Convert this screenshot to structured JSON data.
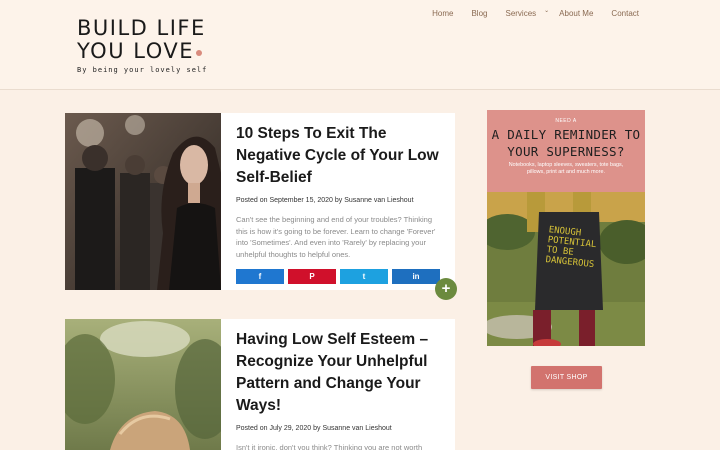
{
  "logo": {
    "line1": "BUILD LIFE",
    "line2": "YOU LOVE",
    "tagline": "By being your lovely self"
  },
  "nav": {
    "items": [
      "Home",
      "Blog",
      "Services",
      "About Me",
      "Contact"
    ]
  },
  "posts": [
    {
      "title": "10 Steps To Exit The Negative Cycle of Your Low Self-Belief",
      "meta_prefix": "Posted on",
      "date": "September 15, 2020",
      "meta_by": "by",
      "author": "Susanne van Lieshout",
      "excerpt": "Can't see the beginning and end of your troubles? Thinking this is how it's going to be forever. Learn to change 'Forever' into 'Sometimes'. And even into 'Rarely' by replacing your unhelpful thoughts to helpful ones."
    },
    {
      "title": "Having Low Self Esteem – Recognize Your Unhelpful Pattern and Change Your Ways!",
      "meta_prefix": "Posted on",
      "date": "July 29, 2020",
      "meta_by": "by",
      "author": "Susanne van Lieshout",
      "excerpt": "Isn't it ironic, don't you think? Thinking you are not worth"
    }
  ],
  "share": {
    "facebook_icon": "f",
    "pinterest_icon": "P",
    "twitter_icon": "t",
    "linkedin_icon": "in"
  },
  "plus": "+",
  "ad": {
    "need": "NEED A",
    "headline": "A DAILY REMINDER TO YOUR SUPERNESS?",
    "sub": "Notebooks, laptop sleeves, sweaters, tote bags, pillows, print art and much more.",
    "bag_text": "ENOUGH POTENTIAL TO BE DANGEROUS"
  },
  "visit_shop": "VISIT SHOP",
  "colors": {
    "background": "#fbf0e6",
    "nav_text": "#8a6a52",
    "accent_green": "#6b8a3e",
    "shop_button": "#d2736e",
    "ad_pink": "#dd928b"
  }
}
